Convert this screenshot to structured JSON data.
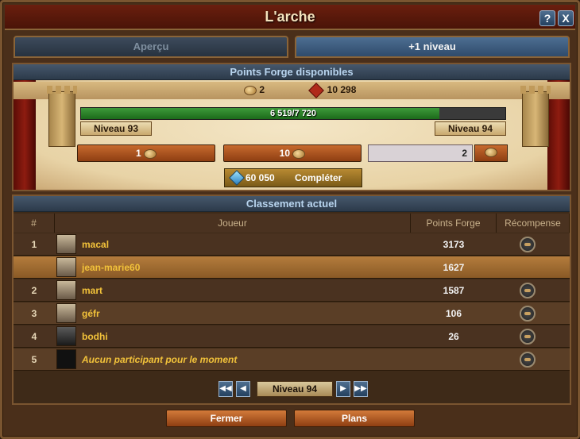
{
  "window": {
    "title": "L'arche",
    "help_label": "?",
    "close_label": "X"
  },
  "tabs": [
    {
      "label": "Aperçu"
    },
    {
      "label": "+1 niveau"
    }
  ],
  "forge": {
    "section_title": "Points Forge disponibles",
    "forge_points": "2",
    "goods": "10 298",
    "progress_text": "6 519/7 720",
    "progress_current": 6519,
    "progress_total": 7720,
    "level_current": "Niveau 93",
    "level_next": "Niveau 94",
    "pay_options": [
      "1",
      "10"
    ],
    "custom_amount": "2",
    "complete_cost": "60 050",
    "complete_label": "Compléter"
  },
  "ranking": {
    "section_title": "Classement actuel",
    "columns": [
      "#",
      "Joueur",
      "Points Forge",
      "Récompense"
    ],
    "rows": [
      {
        "rank": "1",
        "player": "macal",
        "points": "3173"
      },
      {
        "rank": "",
        "player": "jean-marie60",
        "points": "1627"
      },
      {
        "rank": "2",
        "player": "mart",
        "points": "1587"
      },
      {
        "rank": "3",
        "player": "géfr",
        "points": "106"
      },
      {
        "rank": "4",
        "player": "bodhi",
        "points": "26"
      },
      {
        "rank": "5",
        "player": "Aucun participant pour le moment",
        "points": ""
      }
    ],
    "page_label": "Niveau 94",
    "first_icon": "◀◀",
    "prev_icon": "◀",
    "next_icon": "▶",
    "last_icon": "▶▶"
  },
  "footer": {
    "close_label": "Fermer",
    "plans_label": "Plans"
  }
}
